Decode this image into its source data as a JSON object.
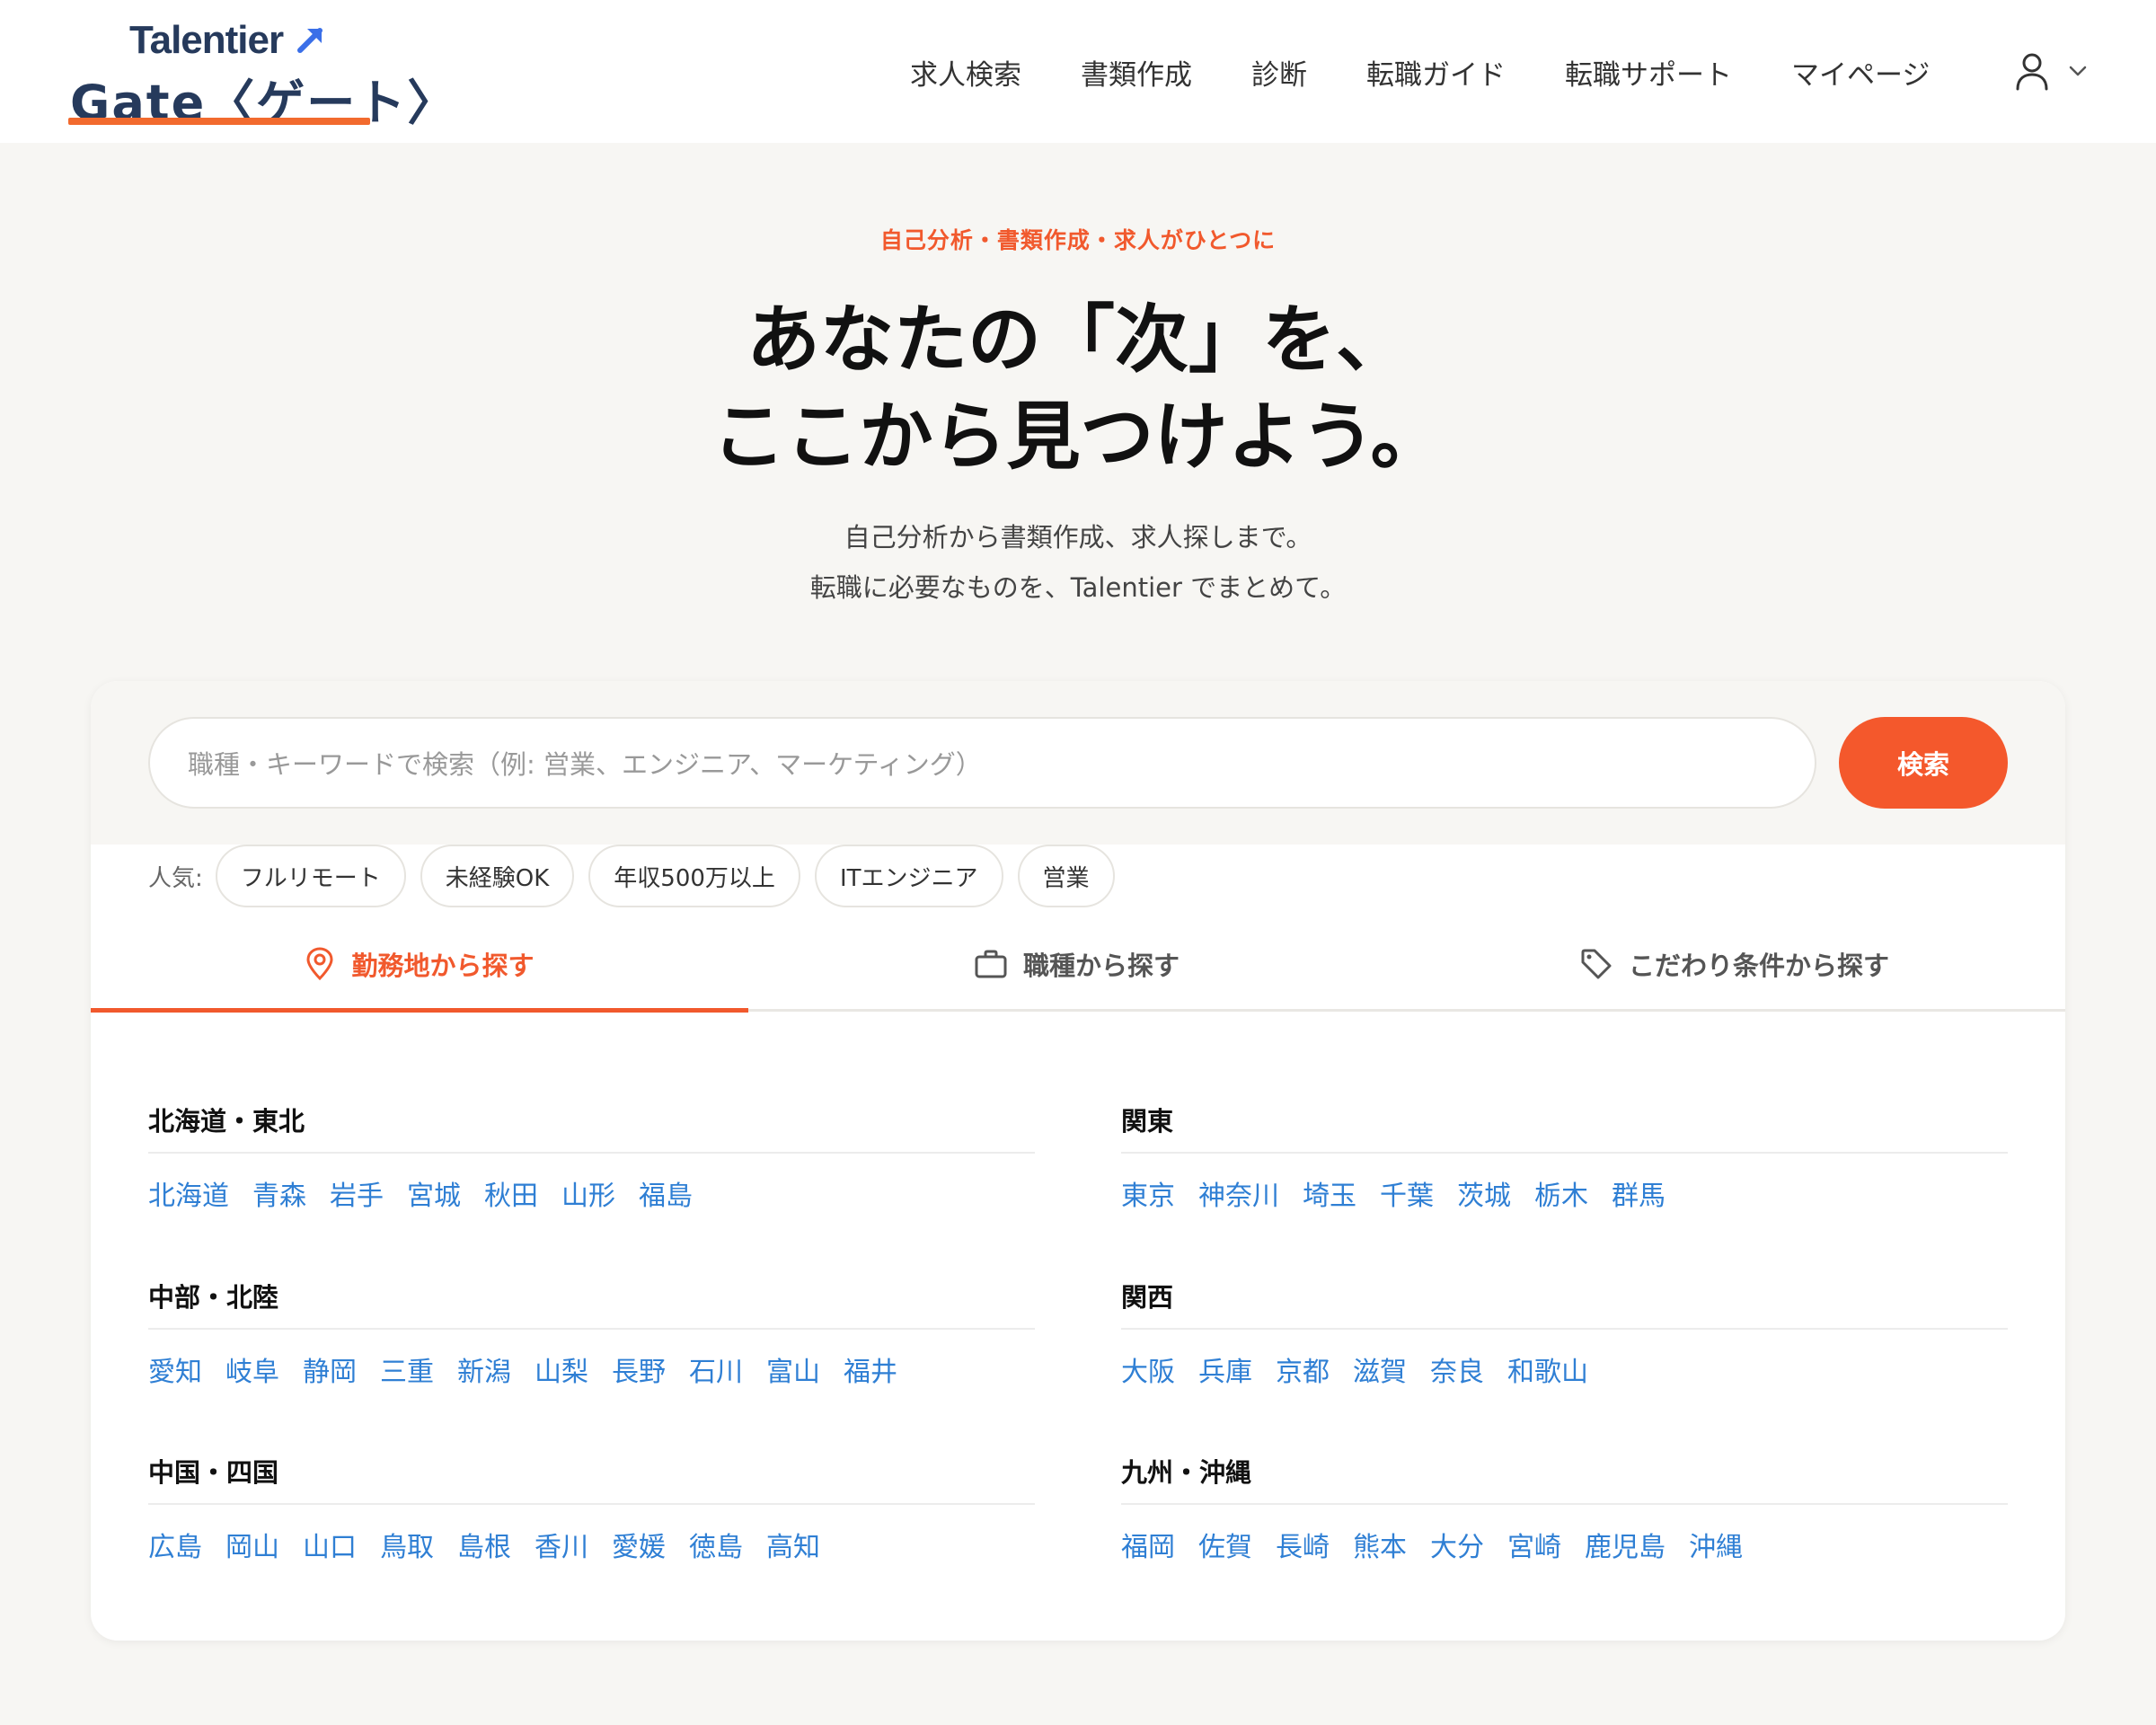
{
  "brand": {
    "top": "Talentier",
    "main": "Gate〈ゲート〉",
    "accent": "#f26a2e",
    "navy": "#263a5c"
  },
  "nav": {
    "items": [
      "求人検索",
      "書類作成",
      "診断",
      "転職ガイド",
      "転職サポート",
      "マイページ"
    ],
    "user_icon": "user-icon",
    "dropdown_icon": "chevron-down-icon"
  },
  "hero": {
    "eyebrow": "自己分析・書類作成・求人がひとつに",
    "title_line1": "あなたの「次」を、",
    "title_line2": "ここから見つけよう。",
    "sub_line1": "自己分析から書類作成、求人探しまで。",
    "sub_line2": "転職に必要なものを、Talentier でまとめて。"
  },
  "search": {
    "placeholder": "職種・キーワードで検索（例: 営業、エンジニア、マーケティング）",
    "button": "検索",
    "button_color": "#f4582c"
  },
  "popular": {
    "label": "人気:",
    "chips": [
      "フルリモート",
      "未経験OK",
      "年収500万以上",
      "ITエンジニア",
      "営業"
    ]
  },
  "tabs": [
    {
      "label": "勤務地から探す",
      "icon": "map-pin-icon",
      "active": true
    },
    {
      "label": "職種から探す",
      "icon": "briefcase-icon",
      "active": false
    },
    {
      "label": "こだわり条件から探す",
      "icon": "tag-icon",
      "active": false
    }
  ],
  "regions": [
    {
      "title": "北海道・東北",
      "prefs": [
        "北海道",
        "青森",
        "岩手",
        "宮城",
        "秋田",
        "山形",
        "福島"
      ]
    },
    {
      "title": "関東",
      "prefs": [
        "東京",
        "神奈川",
        "埼玉",
        "千葉",
        "茨城",
        "栃木",
        "群馬"
      ]
    },
    {
      "title": "中部・北陸",
      "prefs": [
        "愛知",
        "岐阜",
        "静岡",
        "三重",
        "新潟",
        "山梨",
        "長野",
        "石川",
        "富山",
        "福井"
      ]
    },
    {
      "title": "関西",
      "prefs": [
        "大阪",
        "兵庫",
        "京都",
        "滋賀",
        "奈良",
        "和歌山"
      ]
    },
    {
      "title": "中国・四国",
      "prefs": [
        "広島",
        "岡山",
        "山口",
        "鳥取",
        "島根",
        "香川",
        "愛媛",
        "徳島",
        "高知"
      ]
    },
    {
      "title": "九州・沖縄",
      "prefs": [
        "福岡",
        "佐賀",
        "長崎",
        "熊本",
        "大分",
        "宮崎",
        "鹿児島",
        "沖縄"
      ]
    }
  ]
}
